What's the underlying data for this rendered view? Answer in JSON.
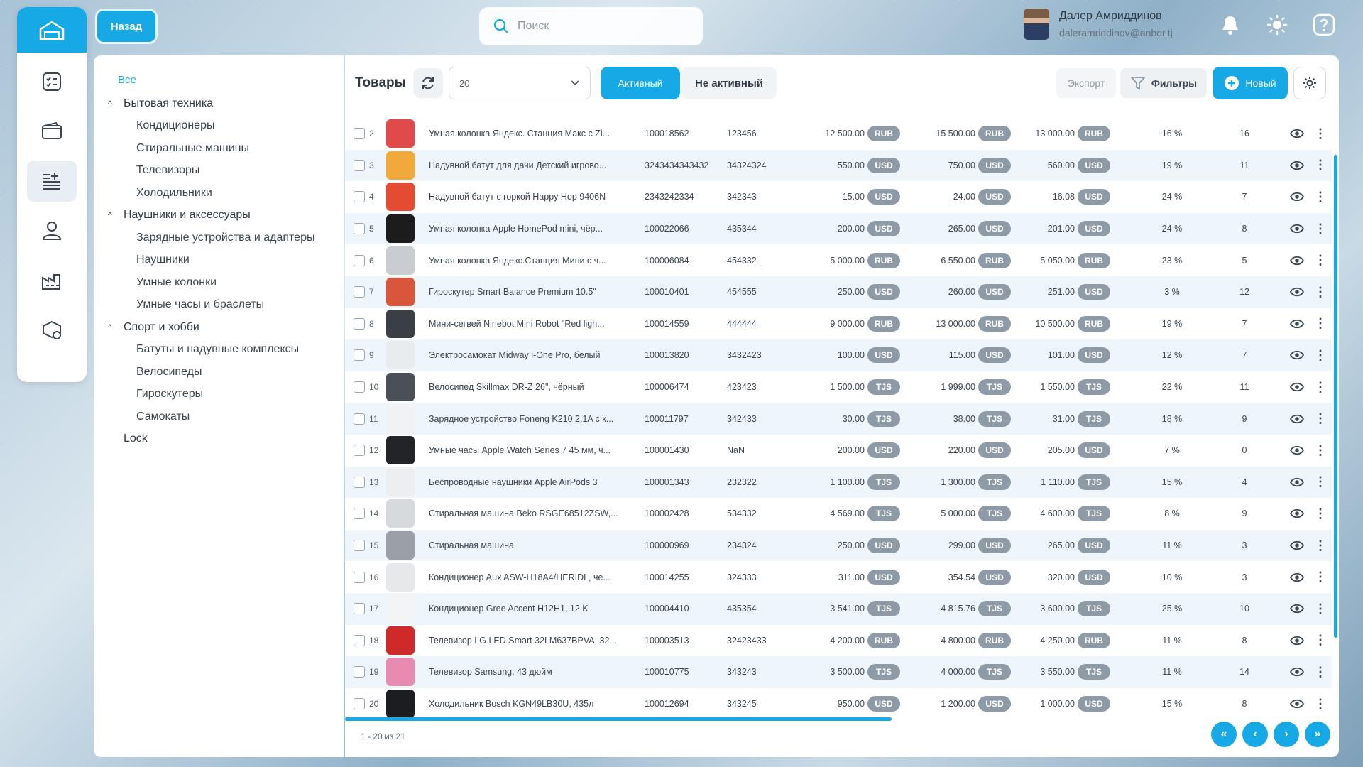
{
  "colors": {
    "accent": "#17a9e6",
    "badge": "#8e9aa5",
    "row_alt": "#eef6fc"
  },
  "header": {
    "back_label": "Назад",
    "search_placeholder": "Поиск",
    "user_name": "Далер Амриддинов",
    "user_email": "daleramriddinov@anbor.tj",
    "icons": [
      "bell-icon",
      "sun-icon",
      "help-icon"
    ]
  },
  "rail": {
    "items": [
      "home-icon",
      "checklist-icon",
      "wallet-icon",
      "product-list-icon",
      "user-icon",
      "factory-icon",
      "settings-box-icon"
    ]
  },
  "categories": {
    "all_label": "Все",
    "groups": [
      {
        "label": "Бытовая техника",
        "children": [
          "Кондиционеры",
          "Стиральные машины",
          "Телевизоры",
          "Холодильники"
        ]
      },
      {
        "label": "Наушники и аксессуары",
        "children": [
          "Зарядные устройства и адаптеры",
          "Наушники",
          "Умные колонки",
          "Умные часы и браслеты"
        ]
      },
      {
        "label": "Спорт и хобби",
        "children": [
          "Батуты и надувные комплексы",
          "Велосипеды",
          "Гироскутеры",
          "Самокаты"
        ]
      }
    ],
    "lock_label": "Lock"
  },
  "toolbar": {
    "title": "Товары",
    "page_size": "20",
    "active_label": "Активный",
    "inactive_label": "Не активный",
    "export_label": "Экспорт",
    "filters_label": "Фильтры",
    "new_label": "Новый"
  },
  "rows": [
    {
      "n": "2",
      "name": "Умная колонка Яндекс. Станция Макс с Zi...",
      "code": "100018562",
      "art": "123456",
      "p1": "12 500.00",
      "c1": "RUB",
      "p2": "15 500.00",
      "c2": "RUB",
      "p3": "13 000.00",
      "c3": "RUB",
      "pct": "16 %",
      "qty": "16",
      "img": "#e04a4a"
    },
    {
      "n": "3",
      "name": "Надувной батут для дачи Детский игрово...",
      "code": "3243434343432",
      "art": "34324324",
      "p1": "550.00",
      "c1": "USD",
      "p2": "750.00",
      "c2": "USD",
      "p3": "560.00",
      "c3": "USD",
      "pct": "19 %",
      "qty": "11",
      "img": "#f0a93a"
    },
    {
      "n": "4",
      "name": "Надувной батут с горкой Happy Hop 9406N",
      "code": "2343242334",
      "art": "342343",
      "p1": "15.00",
      "c1": "USD",
      "p2": "24.00",
      "c2": "USD",
      "p3": "16.08",
      "c3": "USD",
      "pct": "24 %",
      "qty": "7",
      "img": "#e34b33"
    },
    {
      "n": "5",
      "name": "Умная колонка Apple HomePod mini, чёр...",
      "code": "100022066",
      "art": "435344",
      "p1": "200.00",
      "c1": "USD",
      "p2": "265.00",
      "c2": "USD",
      "p3": "201.00",
      "c3": "USD",
      "pct": "24 %",
      "qty": "8",
      "img": "#1c1c1c"
    },
    {
      "n": "6",
      "name": "Умная колонка Яндекс.Станция Мини с ч...",
      "code": "100006084",
      "art": "454332",
      "p1": "5 000.00",
      "c1": "RUB",
      "p2": "6 550.00",
      "c2": "RUB",
      "p3": "5 050.00",
      "c3": "RUB",
      "pct": "23 %",
      "qty": "5",
      "img": "#c9ccd0"
    },
    {
      "n": "7",
      "name": "Гироскутер Smart Balance Premium 10.5\"",
      "code": "100010401",
      "art": "454555",
      "p1": "250.00",
      "c1": "USD",
      "p2": "260.00",
      "c2": "USD",
      "p3": "251.00",
      "c3": "USD",
      "pct": "3 %",
      "qty": "12",
      "img": "#d8563b"
    },
    {
      "n": "8",
      "name": "Мини-сегвей Ninebot Mini Robot \"Red ligh...",
      "code": "100014559",
      "art": "444444",
      "p1": "9 000.00",
      "c1": "RUB",
      "p2": "13 000.00",
      "c2": "RUB",
      "p3": "10 500.00",
      "c3": "RUB",
      "pct": "19 %",
      "qty": "7",
      "img": "#3a3f46"
    },
    {
      "n": "9",
      "name": "Электросамокат Midway i-One Pro, белый",
      "code": "100013820",
      "art": "3432423",
      "p1": "100.00",
      "c1": "USD",
      "p2": "115.00",
      "c2": "USD",
      "p3": "101.00",
      "c3": "USD",
      "pct": "12 %",
      "qty": "7",
      "img": "#e9ecef"
    },
    {
      "n": "10",
      "name": "Велосипед Skillmax DR-Z 26\", чёрный",
      "code": "100006474",
      "art": "423423",
      "p1": "1 500.00",
      "c1": "TJS",
      "p2": "1 999.00",
      "c2": "TJS",
      "p3": "1 550.00",
      "c3": "TJS",
      "pct": "22 %",
      "qty": "11",
      "img": "#4b5058"
    },
    {
      "n": "11",
      "name": "Зарядное устройство Foneng K210 2.1A с к...",
      "code": "100011797",
      "art": "342433",
      "p1": "30.00",
      "c1": "TJS",
      "p2": "38.00",
      "c2": "TJS",
      "p3": "31.00",
      "c3": "TJS",
      "pct": "18 %",
      "qty": "9",
      "img": "#f1f2f4"
    },
    {
      "n": "12",
      "name": "Умные часы Apple Watch Series 7 45 мм, ч...",
      "code": "100001430",
      "art": "NaN",
      "p1": "200.00",
      "c1": "USD",
      "p2": "220.00",
      "c2": "USD",
      "p3": "205.00",
      "c3": "USD",
      "pct": "7 %",
      "qty": "0",
      "img": "#222428"
    },
    {
      "n": "13",
      "name": "Беспроводные наушники Apple AirPods 3",
      "code": "100001343",
      "art": "232322",
      "p1": "1 100.00",
      "c1": "TJS",
      "p2": "1 300.00",
      "c2": "TJS",
      "p3": "1 110.00",
      "c3": "TJS",
      "pct": "15 %",
      "qty": "4",
      "img": "#eceef0"
    },
    {
      "n": "14",
      "name": "Стиральная машина Beko RSGE68512ZSW,...",
      "code": "100002428",
      "art": "534332",
      "p1": "4 569.00",
      "c1": "TJS",
      "p2": "5 000.00",
      "c2": "TJS",
      "p3": "4 600.00",
      "c3": "TJS",
      "pct": "8 %",
      "qty": "9",
      "img": "#d7dadd"
    },
    {
      "n": "15",
      "name": "Стиральная машина",
      "code": "100000969",
      "art": "234324",
      "p1": "250.00",
      "c1": "USD",
      "p2": "299.00",
      "c2": "USD",
      "p3": "265.00",
      "c3": "USD",
      "pct": "11 %",
      "qty": "3",
      "img": "#9aa0a6"
    },
    {
      "n": "16",
      "name": "Кондиционер Aux ASW-H18A4/HERIDL, че...",
      "code": "100014255",
      "art": "324333",
      "p1": "311.00",
      "c1": "USD",
      "p2": "354.54",
      "c2": "USD",
      "p3": "320.00",
      "c3": "USD",
      "pct": "10 %",
      "qty": "3",
      "img": "#e6e8ea"
    },
    {
      "n": "17",
      "name": "Кондиционер Gree Accent H12H1, 12 K",
      "code": "100004410",
      "art": "435354",
      "p1": "3 541.00",
      "c1": "TJS",
      "p2": "4 815.76",
      "c2": "TJS",
      "p3": "3 600.00",
      "c3": "TJS",
      "pct": "25 %",
      "qty": "10",
      "img": "#f3f4f5"
    },
    {
      "n": "18",
      "name": "Телевизор LG LED Smart 32LM637BPVA, 32...",
      "code": "100003513",
      "art": "32423433",
      "p1": "4 200.00",
      "c1": "RUB",
      "p2": "4 800.00",
      "c2": "RUB",
      "p3": "4 250.00",
      "c3": "RUB",
      "pct": "11 %",
      "qty": "8",
      "img": "#cf2a2a"
    },
    {
      "n": "19",
      "name": "Телевизор Samsung, 43 дюйм",
      "code": "100010775",
      "art": "343243",
      "p1": "3 500.00",
      "c1": "TJS",
      "p2": "4 000.00",
      "c2": "TJS",
      "p3": "3 550.00",
      "c3": "TJS",
      "pct": "11 %",
      "qty": "14",
      "img": "#e88bb0"
    },
    {
      "n": "20",
      "name": "Холодильник Bosch KGN49LB30U, 435л",
      "code": "100012694",
      "art": "343245",
      "p1": "950.00",
      "c1": "USD",
      "p2": "1 200.00",
      "c2": "USD",
      "p3": "1 000.00",
      "c3": "USD",
      "pct": "15 %",
      "qty": "8",
      "img": "#1b1d21"
    }
  ],
  "footer": {
    "range": "1 - 20 из 21"
  }
}
